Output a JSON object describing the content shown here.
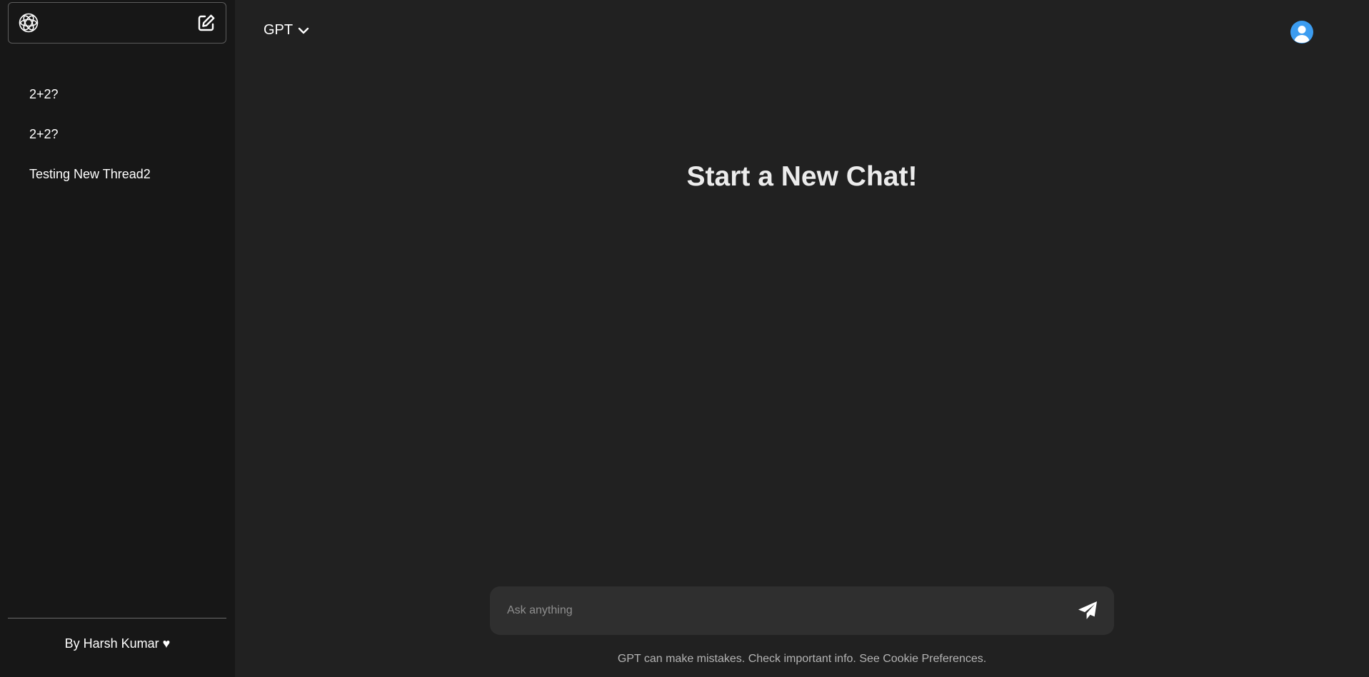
{
  "sidebar": {
    "logo_icon": "openai-logo-icon",
    "new_chat_icon": "edit-icon",
    "threads": [
      {
        "label": "2+2?"
      },
      {
        "label": "2+2?"
      },
      {
        "label": "Testing New Thread2"
      }
    ],
    "footer": "By Harsh Kumar ♥"
  },
  "header": {
    "model_label": "GPT",
    "model_chevron_icon": "chevron-down-icon",
    "avatar_icon": "user-avatar-icon",
    "avatar_color": "#3c9cf0"
  },
  "main": {
    "headline": "Start a New Chat!"
  },
  "composer": {
    "placeholder": "Ask anything",
    "value": "",
    "send_icon": "send-icon"
  },
  "disclaimer": "GPT can make mistakes. Check important info. See Cookie Preferences."
}
